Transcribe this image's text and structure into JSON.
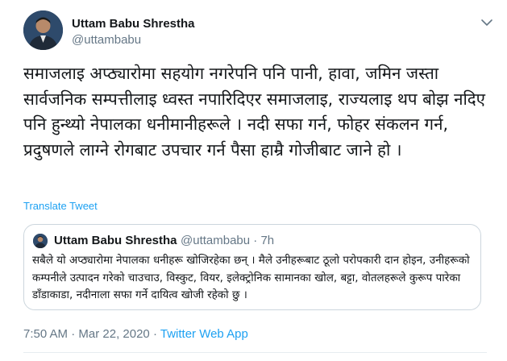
{
  "author": {
    "name": "Uttam Babu Shrestha",
    "handle": "@uttambabu"
  },
  "tweet": {
    "text": "समाजलाइ अप्ठ्यारोमा सहयोग नगरेपनि पनि पानी, हावा, जमिन जस्ता सार्वजनिक सम्पत्तीलाइ ध्वस्त नपारिदिएर समाजलाइ, राज्यलाइ थप बोझ नदिए पनि हुन्थ्यो नेपालका धनीमानीहरूले । नदी सफा गर्न, फोहर संकलन गर्न, प्रदुषणले लाग्ने रोगबाट उपचार गर्न पैसा हाम्रै गोजीबाट जाने हो ।",
    "translate_label": "Translate Tweet"
  },
  "quote": {
    "name": "Uttam Babu Shrestha",
    "handle": "@uttambabu",
    "separator": "·",
    "age": "7h",
    "text": "सबैले यो अप्ठ्यारोमा नेपालका धनीहरू खोजिरहेका छन् । मैले उनीहरूबाट ठूलो परोपकारी दान होइन, उनीहरूको कम्पनीले उत्पादन गरेको चाउचाउ, विस्कुट, वियर, इलेक्ट्रोनिक सामानका खोल, बट्टा, वोतलहरूले कुरूप पारेका डाँडाकाडा, नदीनाला सफा गर्ने दायित्व खोजी रहेको छु ।"
  },
  "footer": {
    "time": "7:50 AM",
    "separator1": "·",
    "date": "Mar 22, 2020",
    "separator2": "·",
    "source": "Twitter Web App"
  },
  "icons": {
    "menu": "chevron-down-icon",
    "avatar": "avatar"
  },
  "colors": {
    "accent": "#1da1f2",
    "secondary_text": "#657786",
    "border": "#ccd6dd"
  }
}
